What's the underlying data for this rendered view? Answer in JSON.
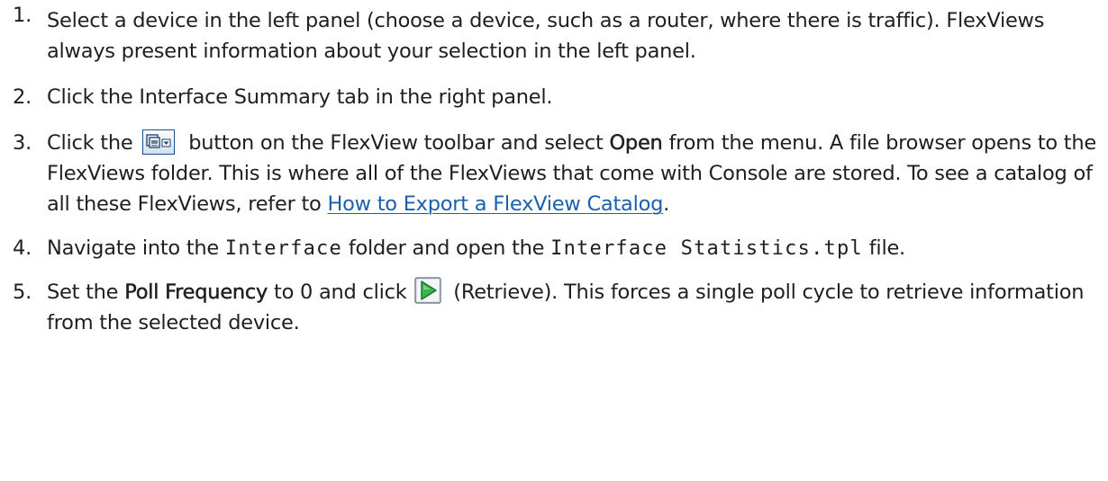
{
  "steps": [
    {
      "number": "1.",
      "text": "Select a device in the left panel (choose a device, such as a router, where there is traffic). FlexViews always present information about your selection in the left panel."
    },
    {
      "number": "2.",
      "text": "Click the Interface Summary tab in the right panel."
    },
    {
      "number": "3.",
      "part1": "Click the",
      "part2": "button on the FlexView toolbar and select",
      "bold": "Open",
      "part3": "from the menu. A file browser opens to the FlexViews folder. This is where all of the FlexViews that come with Console are stored. To see a catalog of all these FlexViews, refer to",
      "link": "How to Export a FlexView Catalog",
      "part4": "."
    },
    {
      "number": "4.",
      "part1": "Navigate into the",
      "code1": "Interface",
      "part2": "folder and open the",
      "code2": "Interface Statistics.tpl",
      "part3": "file."
    },
    {
      "number": "5.",
      "part1": "Set the",
      "bold": "Poll Frequency",
      "part2": "to 0 and click",
      "part3": "(Retrieve). This forces a single poll cycle to retrieve information from the selected device."
    }
  ],
  "icons": {
    "toolbar_button": "open-flexview-menu-icon",
    "retrieve": "play-retrieve-icon"
  },
  "colors": {
    "text": "#1f1f1f",
    "link": "#1a5fb0",
    "play_green": "#39b54a"
  }
}
